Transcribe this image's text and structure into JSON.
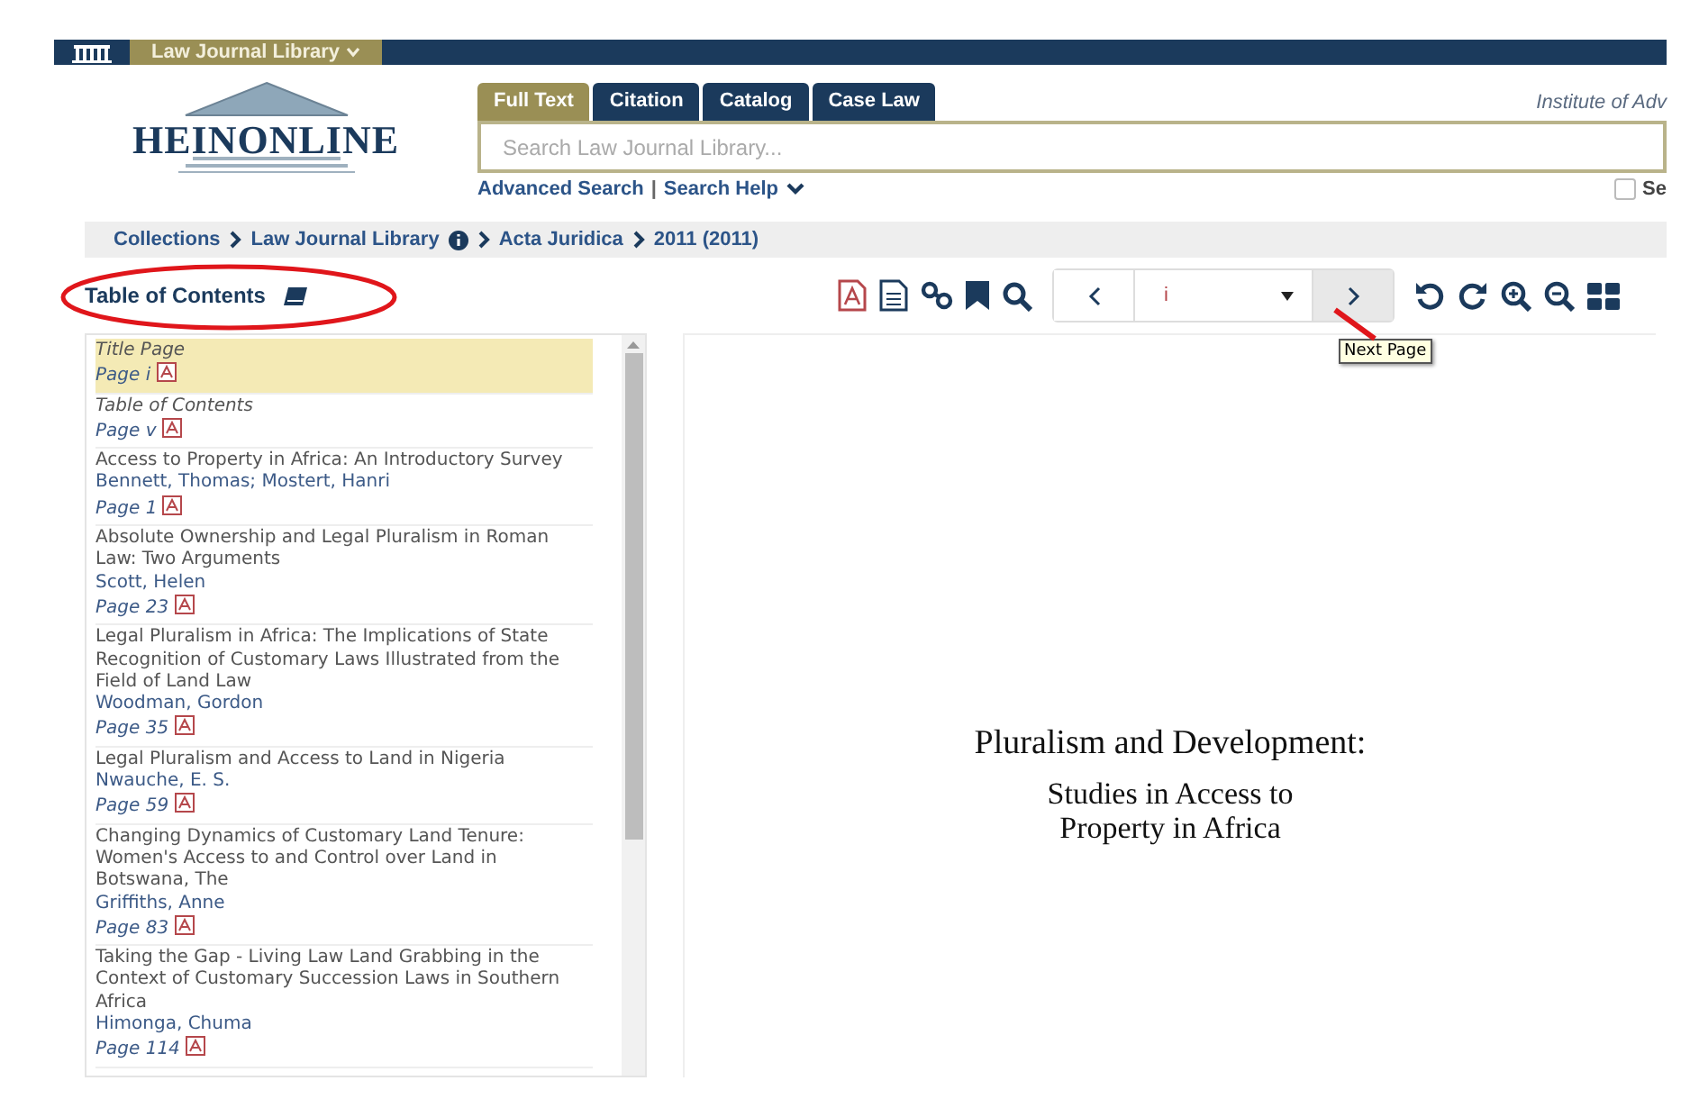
{
  "top_bar": {
    "library_menu": "Law Journal Library"
  },
  "logo": {
    "text": "HEINONLINE"
  },
  "search_tabs": [
    {
      "label": "Full Text",
      "selected": true
    },
    {
      "label": "Citation",
      "selected": false
    },
    {
      "label": "Catalog",
      "selected": false
    },
    {
      "label": "Case Law",
      "selected": false
    }
  ],
  "institution": "Institute of Adv",
  "search": {
    "placeholder": "Search Law Journal Library..."
  },
  "search_links": [
    "Advanced Search",
    "Search Help"
  ],
  "search_link_separator": "|",
  "option_checkbox": {
    "label": "Se",
    "checked": false
  },
  "breadcrumb": [
    {
      "label": "Collections",
      "info": false
    },
    {
      "label": "Law Journal Library",
      "info": true
    },
    {
      "label": "Acta Juridica",
      "info": false
    },
    {
      "label": "2011 (2011)",
      "info": false
    }
  ],
  "toc": {
    "title": "Table of Contents",
    "items": [
      {
        "kind": "front",
        "title": "Title Page",
        "page": "Page i",
        "selected": true
      },
      {
        "kind": "front",
        "title": "Table of Contents",
        "page": "Page v",
        "selected": false
      },
      {
        "kind": "article",
        "title": "Access to Property in Africa: An Introductory Survey",
        "authors": "Bennett, Thomas; Mostert, Hanri",
        "page": "Page 1",
        "selected": false
      },
      {
        "kind": "article",
        "title": "Absolute Ownership and Legal Pluralism in Roman Law: Two Arguments",
        "authors": "Scott, Helen",
        "page": "Page 23",
        "selected": false
      },
      {
        "kind": "article",
        "title": "Legal Pluralism in Africa: The Implications of State Recognition of Customary Laws Illustrated from the Field of Land Law",
        "authors": "Woodman, Gordon",
        "page": "Page 35",
        "selected": false
      },
      {
        "kind": "article",
        "title": "Legal Pluralism and Access to Land in Nigeria",
        "authors": "Nwauche, E. S.",
        "page": "Page 59",
        "selected": false
      },
      {
        "kind": "article",
        "title": "Changing Dynamics of Customary Land Tenure: Women's Access to and Control over Land in Botswana, The",
        "authors": "Griffiths, Anne",
        "page": "Page 83",
        "selected": false
      },
      {
        "kind": "article",
        "title": "Taking the Gap - Living Law Land Grabbing in the Context of Customary Succession Laws in Southern Africa",
        "authors": "Himonga, Chuma",
        "page": "Page 114",
        "selected": false
      }
    ]
  },
  "viewer": {
    "page_select": "i",
    "tooltip": "Next Page",
    "page_title": "Pluralism and Development:",
    "page_subtitle": [
      "Studies in Access to",
      "Property in Africa"
    ]
  }
}
